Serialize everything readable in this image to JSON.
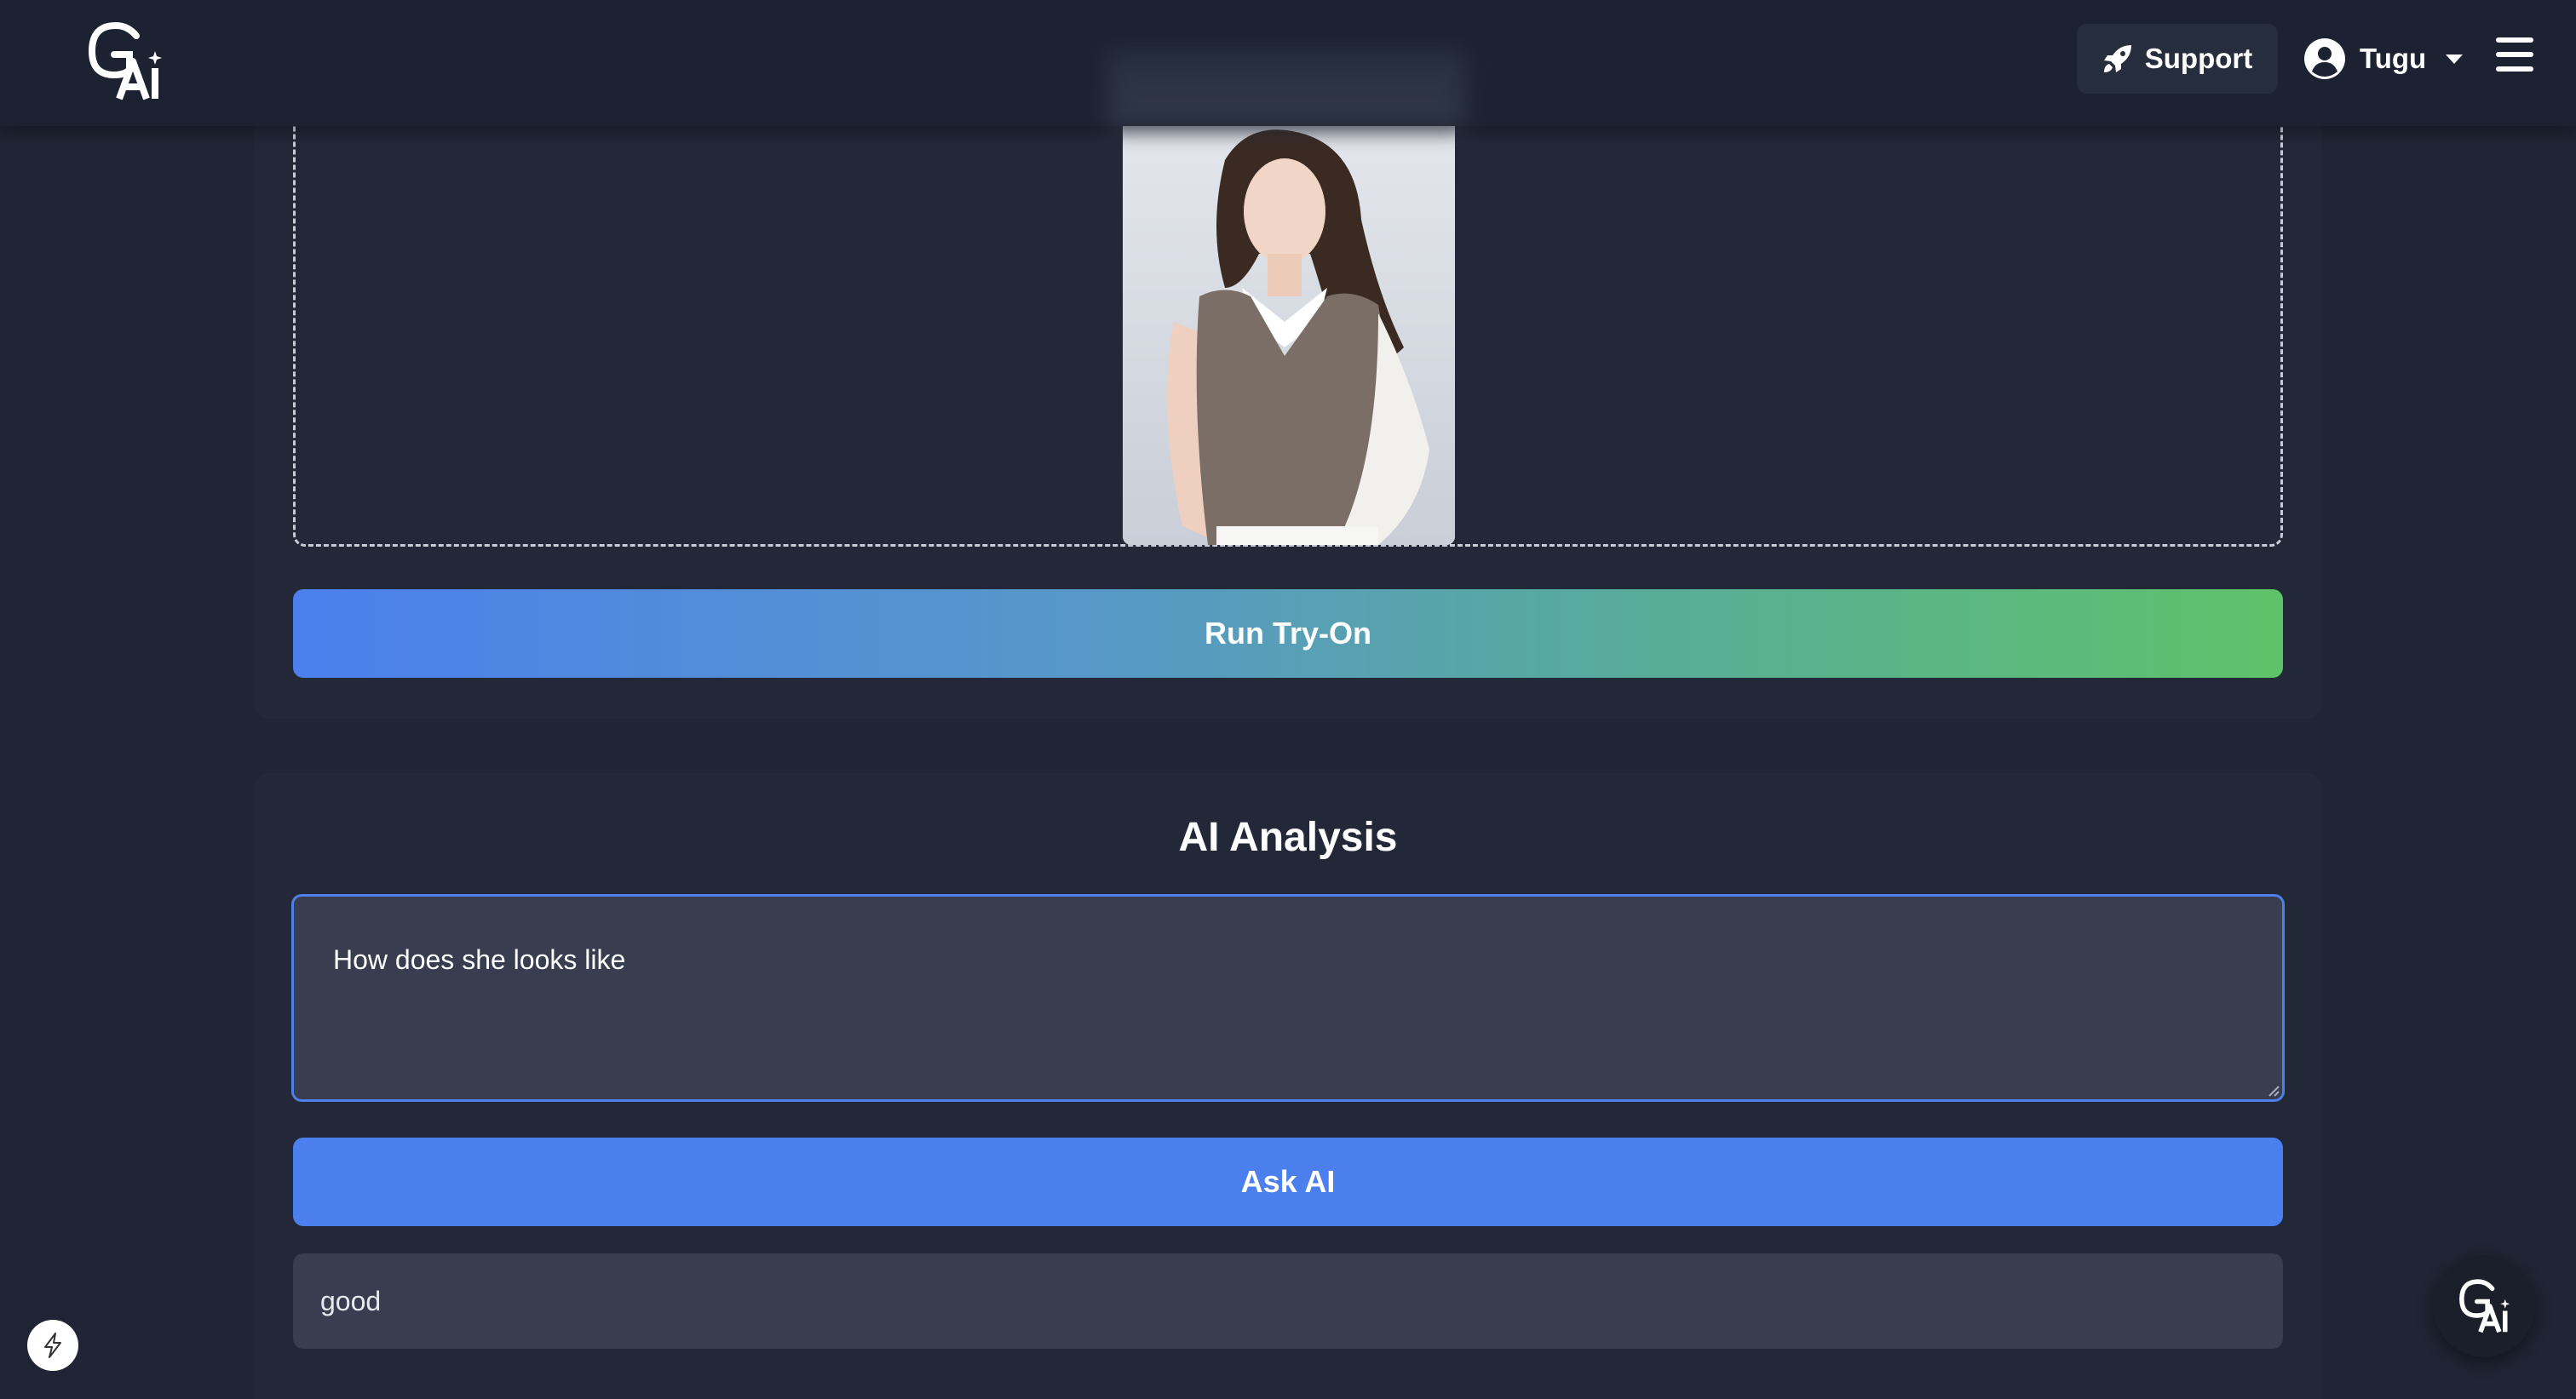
{
  "header": {
    "logo_text": "GAi",
    "support_label": "Support",
    "user_name": "Tugu"
  },
  "tryon": {
    "run_button_label": "Run Try-On"
  },
  "analysis": {
    "title": "AI Analysis",
    "question_value": "How does she looks like",
    "ask_button_label": "Ask AI",
    "answer_text": "good"
  },
  "colors": {
    "background": "#1f2534",
    "card": "#222838",
    "accent_blue": "#4b7fed",
    "accent_green": "#5ec26a",
    "input_bg": "#383e4f"
  },
  "icons": {
    "support": "rocket-icon",
    "user": "user-circle-icon",
    "menu": "hamburger-icon",
    "dev": "lightning-icon",
    "chat": "logo-icon"
  }
}
